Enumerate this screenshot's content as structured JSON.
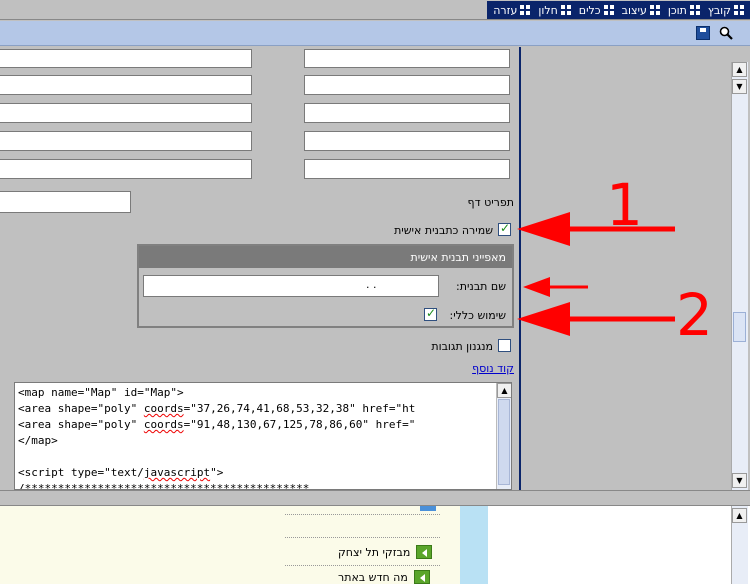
{
  "menubar": {
    "items": [
      {
        "label": "קובץ",
        "icon": "grid-icon"
      },
      {
        "label": "תוכן",
        "icon": "grid-icon"
      },
      {
        "label": "עיצוב",
        "icon": "grid-icon"
      },
      {
        "label": "כלים",
        "icon": "grid-icon"
      },
      {
        "label": "חלון",
        "icon": "grid-icon"
      },
      {
        "label": "עזרה",
        "icon": "grid-icon"
      }
    ]
  },
  "toolbar": {
    "save_icon": "floppy-disk-icon",
    "zoom_icon": "magnifier-icon"
  },
  "form": {
    "page_menu_label": "תפריט דף",
    "save_personal_template_label": "שמירה כתבנית אישית",
    "save_personal_template_checked": true,
    "props_header": "מאפייני תבנית אישית",
    "template_name_label": "שם תבנית:",
    "template_name_value": ". .",
    "general_use_label": "שימוש כללי:",
    "general_use_checked": true,
    "responses_mechanism_label": "מנגנון תגובות",
    "responses_mechanism_checked": false,
    "extra_code_link": "קוד נוסף"
  },
  "code": {
    "line1": "<map name=\"Map\" id=\"Map\">",
    "line2a": "<area shape=\"poly\" ",
    "line2b": "coords",
    "line2c": "=\"37,26,74,41,68,53,32,38\" href=\"ht",
    "line3a": "<area shape=\"poly\" ",
    "line3b": "coords",
    "line3c": "=\"91,48,130,67,125,78,86,60\" href=\"",
    "line4": "</map>",
    "line5": "",
    "line6a": "<script type=\"text/",
    "line6b": "javascript",
    "line6c": "\">",
    "line7": "/*******************************************"
  },
  "preview": {
    "nav": [
      {
        "label": "מבזקי תל יצחק"
      },
      {
        "label": "מה חדש באתר"
      }
    ]
  },
  "annotations": {
    "one": "1",
    "two": "2"
  },
  "colors": {
    "annotation": "#ff0000",
    "menubar": "#0a246a",
    "toolbar": "#b4c7e7"
  }
}
